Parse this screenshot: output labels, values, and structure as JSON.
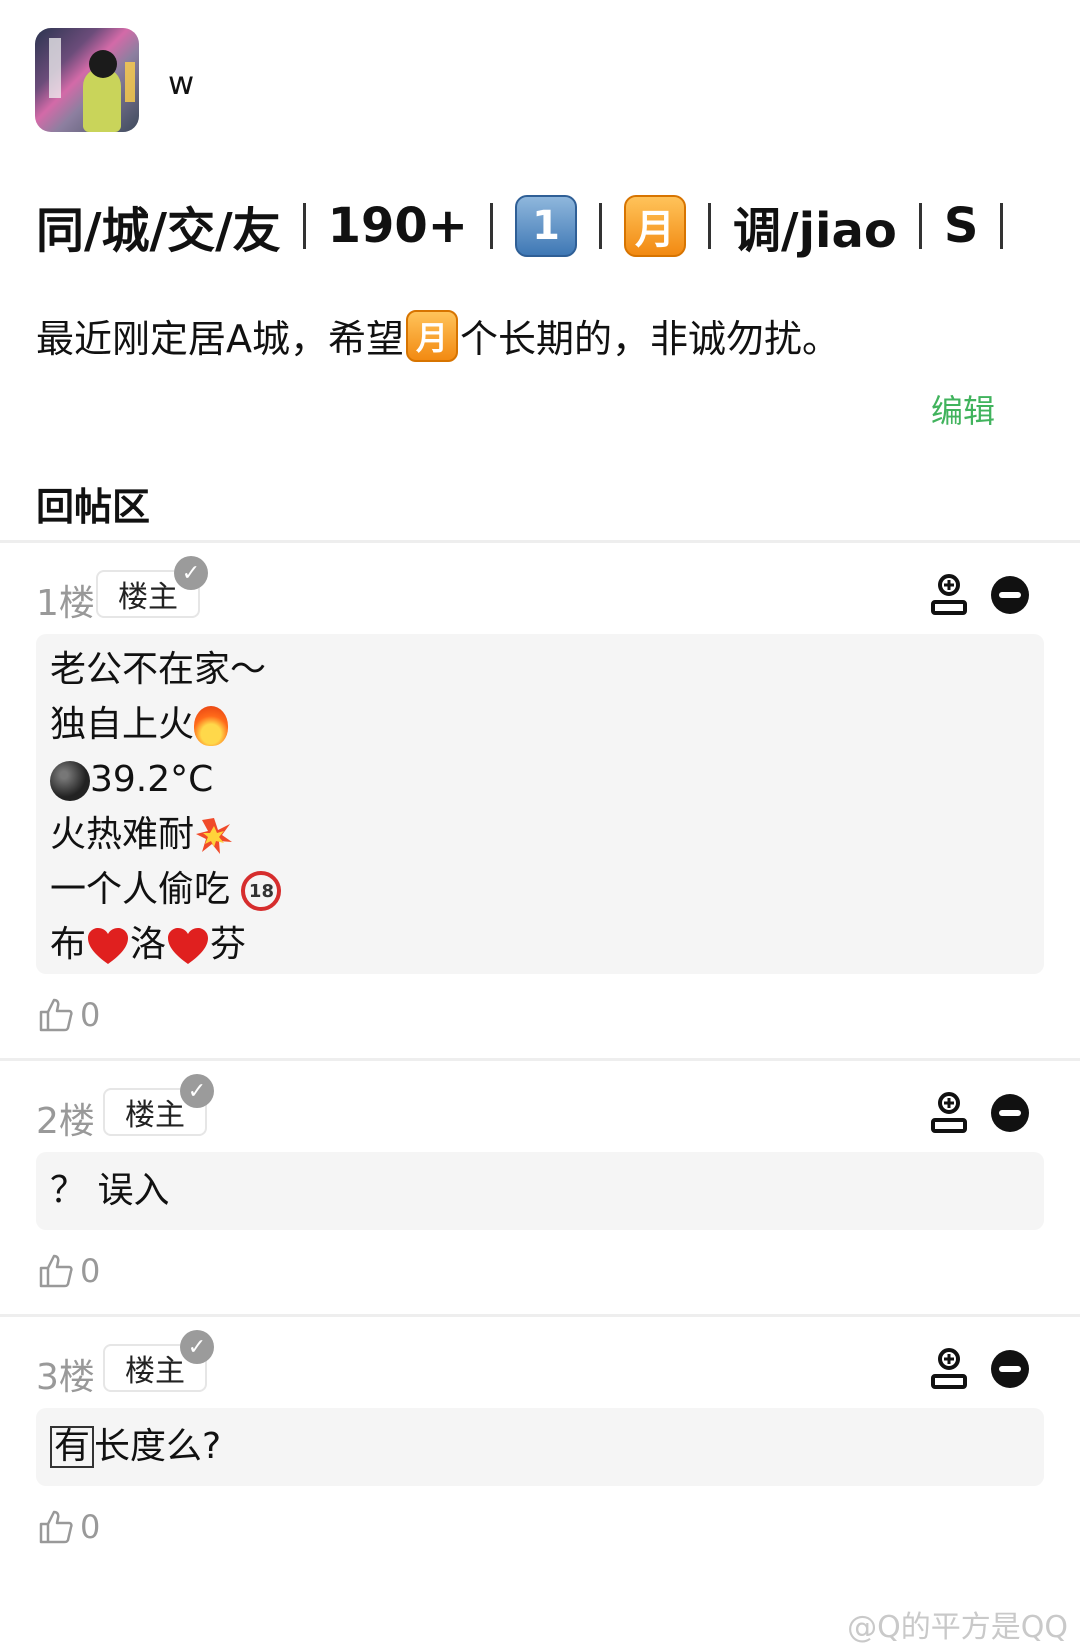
{
  "user": {
    "name": "w"
  },
  "post": {
    "title_parts": [
      "同/城/交/友",
      "190+",
      "1",
      "月",
      "调/jiao",
      "S"
    ],
    "desc_before": "最近刚定居A城，希望",
    "desc_badge": "月",
    "desc_after": "个长期的，非诚勿扰。",
    "edit_label": "编辑"
  },
  "section_title": "回帖区",
  "replies": [
    {
      "floor": "1楼",
      "tag": "楼主",
      "likes": "0",
      "lines": [
        "老公不在家～",
        "独自上火",
        "39.2°C",
        "火热难耐",
        "一个人偷吃 ",
        "布",
        "洛",
        "芬"
      ]
    },
    {
      "floor": "2楼",
      "tag": "楼主",
      "likes": "0",
      "text": "？ 误入"
    },
    {
      "floor": "3楼",
      "tag": "楼主",
      "likes": "0",
      "boxed": "有",
      "text": "长度么?"
    }
  ],
  "icons": {
    "follow": "add-user-icon",
    "block": "minus-circle-icon",
    "like": "thumbs-up-icon",
    "verified": "check-badge-icon",
    "fire": "fire-emoji",
    "bomb": "bomb-emoji",
    "boom": "collision-emoji",
    "no18": "no-under-18-emoji",
    "heart": "red-heart-emoji"
  },
  "colors": {
    "accent": "#41b35d",
    "key_blue": "#3f78b5",
    "key_orange": "#f28a12"
  },
  "watermark": "@Q的平方是QQ"
}
